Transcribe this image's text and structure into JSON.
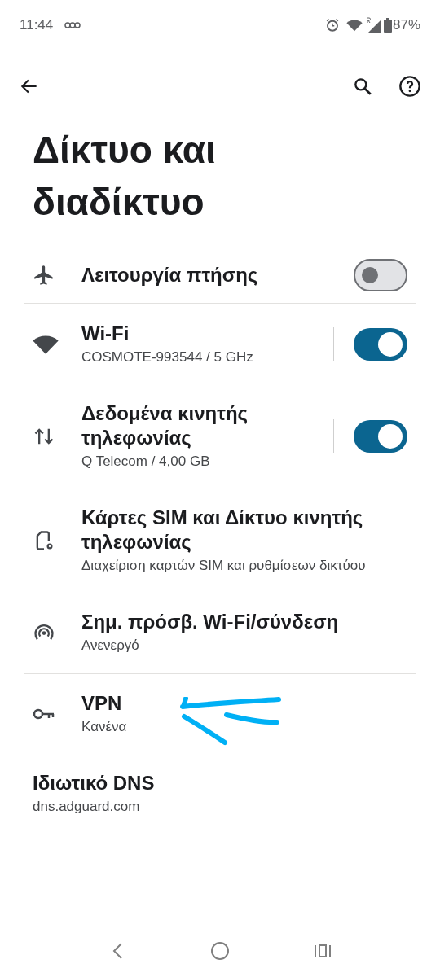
{
  "status_bar": {
    "time": "11:44",
    "battery": "87%"
  },
  "title": "Δίκτυο και διαδίκτυο",
  "items": [
    {
      "kind": "toggle",
      "title": "Λειτουργία πτήσης",
      "on": false,
      "divider_after": true
    },
    {
      "kind": "split_toggle",
      "title": "Wi-Fi",
      "subtitle": "COSMOTE-993544 / 5 GHz",
      "on": true,
      "divider_after": false
    },
    {
      "kind": "split_toggle",
      "title": "Δεδομένα κινητής τηλεφωνίας",
      "subtitle": "Q Telecom / 4,00 GB",
      "on": true,
      "divider_after": false
    },
    {
      "kind": "link",
      "title": "Κάρτες SIM και Δίκτυο κινητής τηλεφωνίας",
      "subtitle": "Διαχείριση καρτών SIM και ρυθμίσεων δικτύου",
      "divider_after": false
    },
    {
      "kind": "link",
      "title": "Σημ. πρόσβ. Wi-Fi/σύνδεση",
      "subtitle": "Ανενεργό",
      "divider_after": true
    },
    {
      "kind": "link",
      "title": "VPN",
      "subtitle": "Κανένα",
      "divider_after": false
    },
    {
      "kind": "plain",
      "title": "Ιδιωτικό DNS",
      "subtitle": "dns.adguard.com",
      "divider_after": false
    }
  ]
}
